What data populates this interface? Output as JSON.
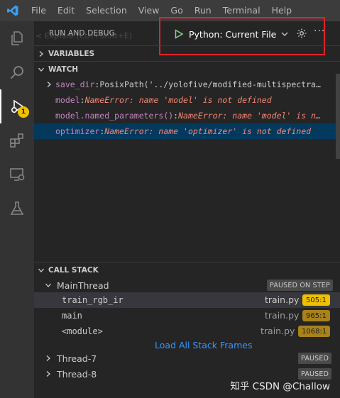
{
  "menu": [
    "File",
    "Edit",
    "Selection",
    "View",
    "Go",
    "Run",
    "Terminal",
    "Help"
  ],
  "activity": {
    "badge": "1"
  },
  "debug": {
    "title": "RUN AND DEBUG",
    "ghost_text": "< Explore (Ctrl+Shift+E)",
    "config_label": "Python: Current File",
    "more_label": "···"
  },
  "sections": {
    "variables": "VARIABLES",
    "watch": "WATCH",
    "call_stack": "CALL STACK"
  },
  "watch": [
    {
      "name": "save_dir",
      "value": "PosixPath('../yolofive/modified-multispectra…",
      "kind": "path",
      "expandable": true
    },
    {
      "name": "model",
      "value": "NameError: name 'model' is not defined",
      "kind": "error",
      "expandable": false
    },
    {
      "name": "model.named_parameters()",
      "value": "NameError: name 'model' is n…",
      "kind": "error",
      "expandable": false
    },
    {
      "name": "optimizer",
      "value": "NameError: name 'optimizer' is not defined",
      "kind": "error",
      "expandable": false
    }
  ],
  "call_stack": {
    "main_thread": {
      "name": "MainThread",
      "status": "PAUSED ON STEP"
    },
    "frames": [
      {
        "name": "train_rgb_ir",
        "file": "train.py",
        "line": "505:1"
      },
      {
        "name": "main",
        "file": "train.py",
        "line": "965:1"
      },
      {
        "name": "<module>",
        "file": "train.py",
        "line": "1068:1"
      }
    ],
    "load_all": "Load All Stack Frames",
    "threads": [
      {
        "name": "Thread-7",
        "status": "PAUSED"
      },
      {
        "name": "Thread-8",
        "status": "PAUSED"
      }
    ]
  },
  "watermark": "CSDN @Challow",
  "watermark_prefix": "知乎 ",
  "colors": {
    "accent_error": "#f48771",
    "watch_name": "#c586c0",
    "highlight_box": "#e0242a",
    "line_badge": "#f0c000",
    "link": "#3794ff"
  }
}
